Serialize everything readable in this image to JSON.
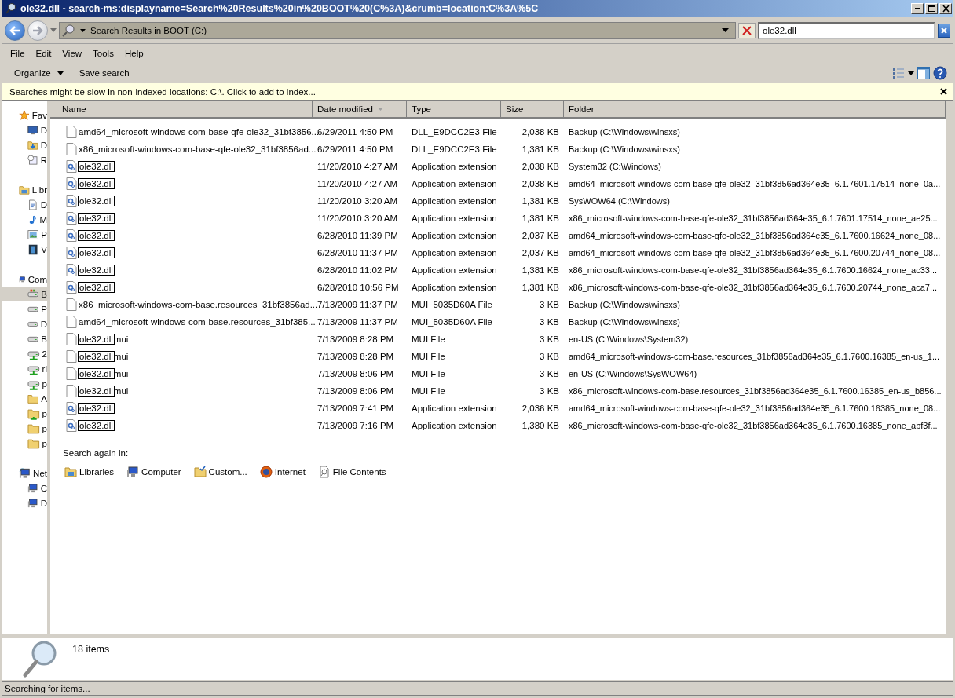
{
  "window": {
    "title": "ole32.dll - search-ms:displayname=Search%20Results%20in%20BOOT%20(C%3A)&crumb=location:C%3A%5C"
  },
  "address": {
    "path": "Search Results in BOOT (C:)"
  },
  "search": {
    "value": "ole32.dll"
  },
  "menu": [
    "File",
    "Edit",
    "View",
    "Tools",
    "Help"
  ],
  "toolbar": [
    {
      "label": "Organize",
      "kind": "menu"
    },
    {
      "label": "Save search",
      "kind": "plain"
    }
  ],
  "info_bar": {
    "text": "Searches might be slow in non-indexed locations: C:\\. Click to add to index..."
  },
  "nav": [
    {
      "label": "Fav",
      "kind": "star",
      "selected": false,
      "children": [
        {
          "label": "D",
          "kind": "desktop",
          "selected": false
        },
        {
          "label": "D",
          "kind": "downloads",
          "selected": false
        },
        {
          "label": "R",
          "kind": "recent",
          "selected": false
        }
      ]
    },
    {
      "label": "Libr",
      "kind": "library",
      "selected": false,
      "children": [
        {
          "label": "D",
          "kind": "document",
          "selected": false
        },
        {
          "label": "M",
          "kind": "music",
          "selected": false
        },
        {
          "label": "P",
          "kind": "picture",
          "selected": false
        },
        {
          "label": "V",
          "kind": "video",
          "selected": false
        }
      ]
    },
    {
      "label": "Com",
      "kind": "computer",
      "selected": false,
      "children": [
        {
          "label": "B",
          "kind": "windrive",
          "selected": true
        },
        {
          "label": "P",
          "kind": "drive",
          "selected": false
        },
        {
          "label": "D",
          "kind": "drive",
          "selected": false
        },
        {
          "label": "B",
          "kind": "drive",
          "selected": false
        },
        {
          "label": "2",
          "kind": "netdrive",
          "selected": false
        },
        {
          "label": "ri",
          "kind": "netdrive",
          "selected": false
        },
        {
          "label": "p",
          "kind": "netdrive",
          "selected": false
        },
        {
          "label": "A",
          "kind": "folder",
          "selected": false
        },
        {
          "label": "p",
          "kind": "sharedfolder",
          "selected": false
        },
        {
          "label": "p",
          "kind": "folder",
          "selected": false
        },
        {
          "label": "p",
          "kind": "folder",
          "selected": false
        }
      ]
    },
    {
      "label": "Net",
      "kind": "network",
      "selected": false,
      "children": [
        {
          "label": "C",
          "kind": "pc",
          "selected": false
        },
        {
          "label": "D",
          "kind": "pc",
          "selected": false
        }
      ]
    }
  ],
  "table": {
    "columns": [
      {
        "label": "Name",
        "sorted": false
      },
      {
        "label": "Date modified",
        "sorted": true
      },
      {
        "label": "Type",
        "sorted": false
      },
      {
        "label": "Size",
        "sorted": false
      },
      {
        "label": "Folder",
        "sorted": false
      }
    ],
    "rows": [
      {
        "kind": "blank",
        "name": "amd64_microsoft-windows-com-base-qfe-ole32_31bf3856...",
        "date": "6/29/2011 4:50 PM",
        "type": "DLL_E9DCC2E3 File",
        "size": "2,038 KB",
        "folder": "Backup (C:\\Windows\\winsxs)"
      },
      {
        "kind": "blank",
        "name": "x86_microsoft-windows-com-base-qfe-ole32_31bf3856ad...",
        "date": "6/29/2011 4:50 PM",
        "type": "DLL_E9DCC2E3 File",
        "size": "1,381 KB",
        "folder": "Backup (C:\\Windows\\winsxs)"
      },
      {
        "kind": "dll",
        "match": "ole32.dll",
        "date": "11/20/2010 4:27 AM",
        "type": "Application extension",
        "size": "2,038 KB",
        "folder": "System32 (C:\\Windows)"
      },
      {
        "kind": "dll",
        "match": "ole32.dll",
        "date": "11/20/2010 4:27 AM",
        "type": "Application extension",
        "size": "2,038 KB",
        "folder": "amd64_microsoft-windows-com-base-qfe-ole32_31bf3856ad364e35_6.1.7601.17514_none_0a..."
      },
      {
        "kind": "dll",
        "match": "ole32.dll",
        "date": "11/20/2010 3:20 AM",
        "type": "Application extension",
        "size": "1,381 KB",
        "folder": "SysWOW64 (C:\\Windows)"
      },
      {
        "kind": "dll",
        "match": "ole32.dll",
        "date": "11/20/2010 3:20 AM",
        "type": "Application extension",
        "size": "1,381 KB",
        "folder": "x86_microsoft-windows-com-base-qfe-ole32_31bf3856ad364e35_6.1.7601.17514_none_ae25..."
      },
      {
        "kind": "dll",
        "match": "ole32.dll",
        "date": "6/28/2010 11:39 PM",
        "type": "Application extension",
        "size": "2,037 KB",
        "folder": "amd64_microsoft-windows-com-base-qfe-ole32_31bf3856ad364e35_6.1.7600.16624_none_08..."
      },
      {
        "kind": "dll",
        "match": "ole32.dll",
        "date": "6/28/2010 11:37 PM",
        "type": "Application extension",
        "size": "2,037 KB",
        "folder": "amd64_microsoft-windows-com-base-qfe-ole32_31bf3856ad364e35_6.1.7600.20744_none_08..."
      },
      {
        "kind": "dll",
        "match": "ole32.dll",
        "date": "6/28/2010 11:02 PM",
        "type": "Application extension",
        "size": "1,381 KB",
        "folder": "x86_microsoft-windows-com-base-qfe-ole32_31bf3856ad364e35_6.1.7600.16624_none_ac33..."
      },
      {
        "kind": "dll",
        "match": "ole32.dll",
        "date": "6/28/2010 10:56 PM",
        "type": "Application extension",
        "size": "1,381 KB",
        "folder": "x86_microsoft-windows-com-base-qfe-ole32_31bf3856ad364e35_6.1.7600.20744_none_aca7..."
      },
      {
        "kind": "blank",
        "name": "x86_microsoft-windows-com-base.resources_31bf3856ad...",
        "date": "7/13/2009 11:37 PM",
        "type": "MUI_5035D60A File",
        "size": "3 KB",
        "folder": "Backup (C:\\Windows\\winsxs)"
      },
      {
        "kind": "blank",
        "name": "amd64_microsoft-windows-com-base.resources_31bf385...",
        "date": "7/13/2009 11:37 PM",
        "type": "MUI_5035D60A File",
        "size": "3 KB",
        "folder": "Backup (C:\\Windows\\winsxs)"
      },
      {
        "kind": "blank",
        "match": "ole32.dll",
        "rest": "mui",
        "date": "7/13/2009 8:28 PM",
        "type": "MUI File",
        "size": "3 KB",
        "folder": "en-US (C:\\Windows\\System32)"
      },
      {
        "kind": "blank",
        "match": "ole32.dll",
        "rest": "mui",
        "date": "7/13/2009 8:28 PM",
        "type": "MUI File",
        "size": "3 KB",
        "folder": "amd64_microsoft-windows-com-base.resources_31bf3856ad364e35_6.1.7600.16385_en-us_1..."
      },
      {
        "kind": "blank",
        "match": "ole32.dll",
        "rest": "mui",
        "date": "7/13/2009 8:06 PM",
        "type": "MUI File",
        "size": "3 KB",
        "folder": "en-US (C:\\Windows\\SysWOW64)"
      },
      {
        "kind": "blank",
        "match": "ole32.dll",
        "rest": "mui",
        "date": "7/13/2009 8:06 PM",
        "type": "MUI File",
        "size": "3 KB",
        "folder": "x86_microsoft-windows-com-base.resources_31bf3856ad364e35_6.1.7600.16385_en-us_b856..."
      },
      {
        "kind": "dll",
        "match": "ole32.dll",
        "date": "7/13/2009 7:41 PM",
        "type": "Application extension",
        "size": "2,036 KB",
        "folder": "amd64_microsoft-windows-com-base-qfe-ole32_31bf3856ad364e35_6.1.7600.16385_none_08..."
      },
      {
        "kind": "dll",
        "match": "ole32.dll",
        "date": "7/13/2009 7:16 PM",
        "type": "Application extension",
        "size": "1,380 KB",
        "folder": "x86_microsoft-windows-com-base-qfe-ole32_31bf3856ad364e35_6.1.7600.16385_none_abf3f..."
      }
    ]
  },
  "search_again": {
    "label": "Search again in:",
    "items": [
      {
        "label": "Libraries",
        "kind": "libraries"
      },
      {
        "label": "Computer",
        "kind": "computer"
      },
      {
        "label": "Custom...",
        "kind": "custom"
      },
      {
        "label": "Internet",
        "kind": "internet"
      },
      {
        "label": "File Contents",
        "kind": "contents"
      }
    ]
  },
  "details": {
    "count": "18 items"
  },
  "status_bar": {
    "text": "Searching for items..."
  }
}
